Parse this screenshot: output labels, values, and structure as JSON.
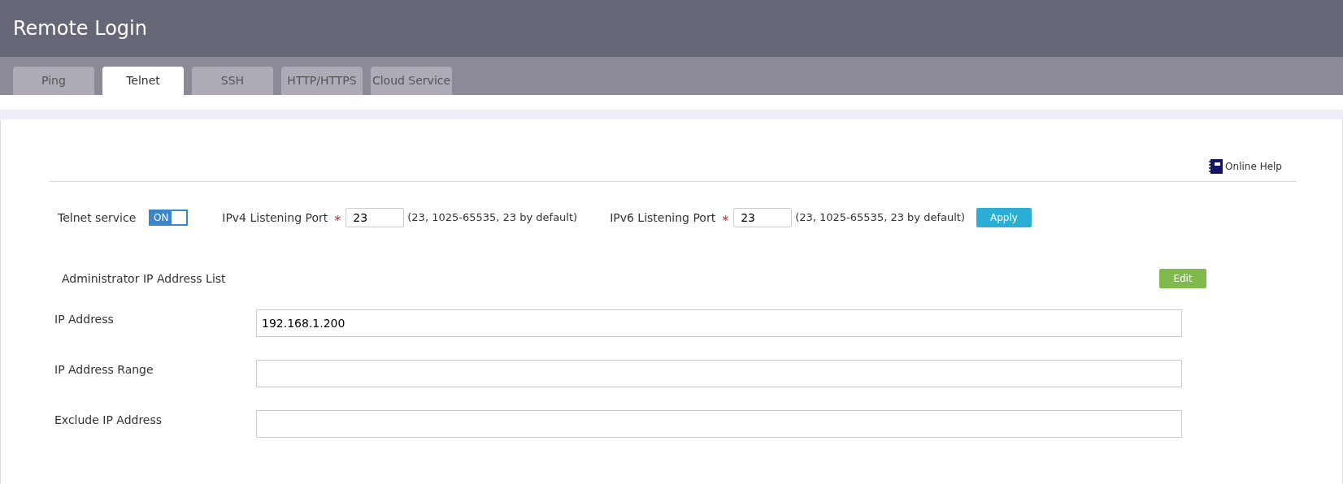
{
  "header": {
    "title": "Remote Login"
  },
  "tabs": [
    {
      "label": "Ping",
      "selected": false
    },
    {
      "label": "Telnet",
      "selected": true
    },
    {
      "label": "SSH",
      "selected": false
    },
    {
      "label": "HTTP/HTTPS",
      "selected": false
    },
    {
      "label": "Cloud Service",
      "selected": false
    }
  ],
  "help_link": "Online Help",
  "telnet_service": {
    "label": "Telnet service",
    "toggle_text": "ON",
    "on": true
  },
  "ports": [
    {
      "label": "IPv4 Listening Port",
      "required_mark": "*",
      "value": "23",
      "hint": "(23, 1025-65535, 23 by default)"
    },
    {
      "label": "IPv6 Listening Port",
      "required_mark": "*",
      "value": "23",
      "hint": "(23, 1025-65535, 23 by default)"
    }
  ],
  "apply_button": "Apply",
  "admin_list": {
    "title": "Administrator IP Address List",
    "edit_button": "Edit",
    "fields": [
      {
        "label": "IP Address",
        "value": "192.168.1.200"
      },
      {
        "label": "IP Address Range"
      },
      {
        "label": "Exclude IP Address"
      }
    ]
  }
}
